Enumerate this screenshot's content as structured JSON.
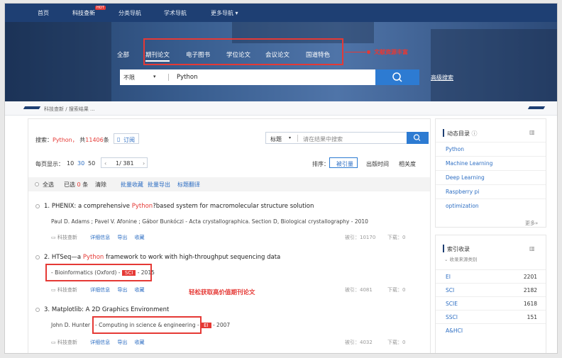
{
  "nav": {
    "items": [
      "首页",
      "科技查新",
      "分类导航",
      "学术导航",
      "更多导航 ▾"
    ],
    "hot_badge": "HOT"
  },
  "hero": {
    "tabs": [
      "全部",
      "期刊论文",
      "电子图书",
      "学位论文",
      "会议论文",
      "国道特色"
    ],
    "annotation": "文献资源丰富",
    "scope": "不限",
    "query": "Python",
    "advanced": "高级搜索"
  },
  "breadcrumb": {
    "home": "科技查新",
    "sep": "/",
    "current": "搜索结果 ..."
  },
  "results_header": {
    "search_label": "搜索：",
    "query": "Python，",
    "total_prefix": "共",
    "total": "11406",
    "total_suffix": "条",
    "subscribe": "订阅",
    "field": "标题",
    "within_placeholder": "请在结果中搜索",
    "per_page_label": "每页显示：",
    "per_page_options": [
      "10",
      "30",
      "50"
    ],
    "page": "1/ 381",
    "sort_label": "排序：",
    "sort_options": [
      "被引量",
      "出版时间",
      "相关度"
    ]
  },
  "toolbar": {
    "select_all": "全选",
    "selected_prefix": "已选",
    "selected_count": "0",
    "selected_suffix": "条",
    "clear": "清除",
    "batch_collect": "批量收藏",
    "batch_export": "批量导出",
    "translate": "标题翻译"
  },
  "results": [
    {
      "num": "1.",
      "title_pre": "PHENIX: a comprehensive ",
      "title_hl": "Python",
      "title_post": "?based system for macromolecular structure solution",
      "meta": "Paul D. Adams ; Pavel V. Afonine ; Gábor Bunkóczi - Acta crystallographica. Section D, Biological crystallography - 2010",
      "cited": "被引：10170",
      "downloads": "下载：0"
    },
    {
      "num": "2.",
      "title_pre": "HTSeq—a ",
      "title_hl": "Python",
      "title_post": " framework to work with high-throughput sequencing data",
      "meta_pre": "- Bioinformatics (Oxford) -",
      "badge": "SCI",
      "meta_post": "- 2015",
      "cited": "被引：4081",
      "downloads": "下载：0"
    },
    {
      "num": "3.",
      "title": "Matplotlib: A 2D Graphics Environment",
      "author": "John D. Hunter",
      "meta_pre": "- Computing in science & engineering -",
      "badge": "EI",
      "meta_post": "- 2007",
      "cited": "被引：4032",
      "downloads": "下载：0"
    }
  ],
  "result_actions": [
    "科技查新",
    "详细信息",
    "导出",
    "收藏"
  ],
  "annotation2": "轻松获取高价值期刊论文",
  "sidebar": {
    "dynamic_title": "动态目录",
    "dynamic_items": [
      "Python",
      "Machine Learning",
      "Deep Learning",
      "Raspberry pi",
      "optimization"
    ],
    "more": "更多»",
    "index_title": "索引收录",
    "index_sub": "收录来源类别",
    "index_items": [
      {
        "name": "EI",
        "count": "2201"
      },
      {
        "name": "SCI",
        "count": "2182"
      },
      {
        "name": "SCIE",
        "count": "1618"
      },
      {
        "name": "SSCI",
        "count": "151"
      },
      {
        "name": "A&HCI",
        "count": ""
      }
    ]
  }
}
